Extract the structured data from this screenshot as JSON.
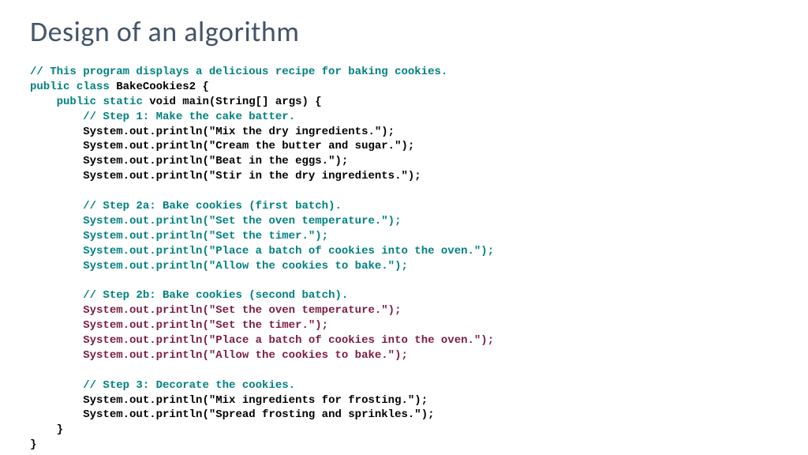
{
  "title": "Design of an algorithm",
  "code": {
    "c0": "// This program displays a delicious recipe for baking cookies.",
    "kw_public": "public",
    "kw_class": "class",
    "classname": " BakeCookies2 {",
    "kw_static": "static",
    "main_sig": " void main(String[] args) {",
    "step1_c": "// Step 1: Make the cake batter.",
    "s1l1": "System.out.println(\"Mix the dry ingredients.\");",
    "s1l2": "System.out.println(\"Cream the butter and sugar.\");",
    "s1l3": "System.out.println(\"Beat in the eggs.\");",
    "s1l4": "System.out.println(\"Stir in the dry ingredients.\");",
    "step2a_c": "// Step 2a: Bake cookies (first batch).",
    "s2a1": "System.out.println(\"Set the oven temperature.\");",
    "s2a2": "System.out.println(\"Set the timer.\");",
    "s2a3": "System.out.println(\"Place a batch of cookies into the oven.\");",
    "s2a4": "System.out.println(\"Allow the cookies to bake.\");",
    "step2b_c": "// Step 2b: Bake cookies (second batch).",
    "s2b1": "System.out.println(\"Set the oven temperature.\");",
    "s2b2": "System.out.println(\"Set the timer.\");",
    "s2b3": "System.out.println(\"Place a batch of cookies into the oven.\");",
    "s2b4": "System.out.println(\"Allow the cookies to bake.\");",
    "step3_c": "// Step 3: Decorate the cookies.",
    "s3l1": "System.out.println(\"Mix ingredients for frosting.\");",
    "s3l2": "System.out.println(\"Spread frosting and sprinkles.\");",
    "close_inner": "    }",
    "close_outer": "}"
  }
}
